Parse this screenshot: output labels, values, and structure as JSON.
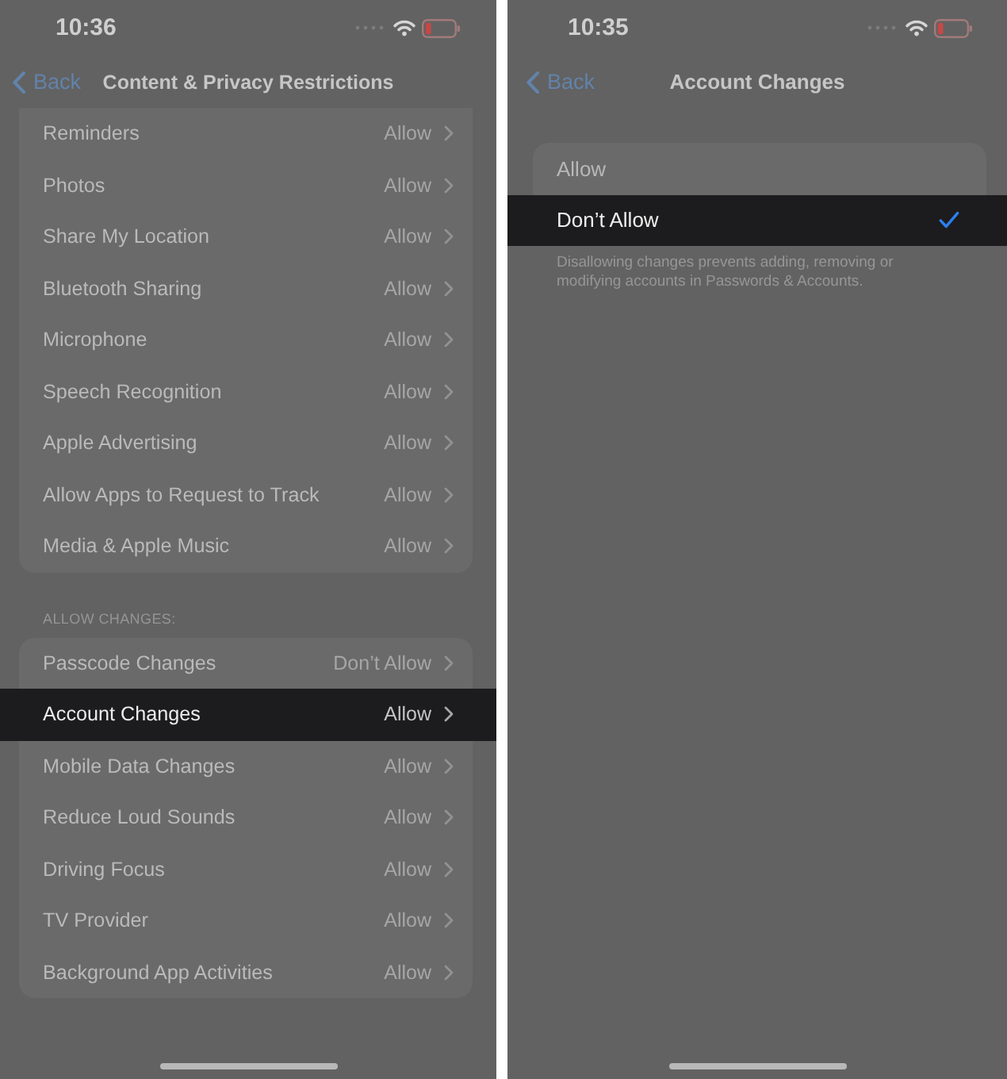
{
  "left_screen": {
    "status_bar": {
      "time": "10:36"
    },
    "nav_bar": {
      "back": "Back",
      "title": "Content & Privacy Restrictions"
    },
    "groups": [
      {
        "rows": [
          {
            "label": "Reminders",
            "value": "Allow",
            "selected": false
          },
          {
            "label": "Photos",
            "value": "Allow",
            "selected": false
          },
          {
            "label": "Share My Location",
            "value": "Allow",
            "selected": false
          },
          {
            "label": "Bluetooth Sharing",
            "value": "Allow",
            "selected": false
          },
          {
            "label": "Microphone",
            "value": "Allow",
            "selected": false
          },
          {
            "label": "Speech Recognition",
            "value": "Allow",
            "selected": false
          },
          {
            "label": "Apple Advertising",
            "value": "Allow",
            "selected": false
          },
          {
            "label": "Allow Apps to Request to Track",
            "value": "Allow",
            "selected": false
          },
          {
            "label": "Media & Apple Music",
            "value": "Allow",
            "selected": false
          }
        ]
      },
      {
        "header": "ALLOW CHANGES:",
        "rows": [
          {
            "label": "Passcode Changes",
            "value": "Don’t Allow",
            "selected": false
          },
          {
            "label": "Account Changes",
            "value": "Allow",
            "selected": true
          },
          {
            "label": "Mobile Data Changes",
            "value": "Allow",
            "selected": false
          },
          {
            "label": "Reduce Loud Sounds",
            "value": "Allow",
            "selected": false
          },
          {
            "label": "Driving Focus",
            "value": "Allow",
            "selected": false
          },
          {
            "label": "TV Provider",
            "value": "Allow",
            "selected": false
          },
          {
            "label": "Background App Activities",
            "value": "Allow",
            "selected": false
          }
        ]
      }
    ]
  },
  "right_screen": {
    "status_bar": {
      "time": "10:35"
    },
    "nav_bar": {
      "back": "Back",
      "title": "Account Changes"
    },
    "options": [
      {
        "label": "Allow",
        "selected": false
      },
      {
        "label": "Don’t Allow",
        "selected": true
      }
    ],
    "footer": "Disallowing changes prevents adding, removing or modifying accounts in Passwords & Accounts."
  }
}
